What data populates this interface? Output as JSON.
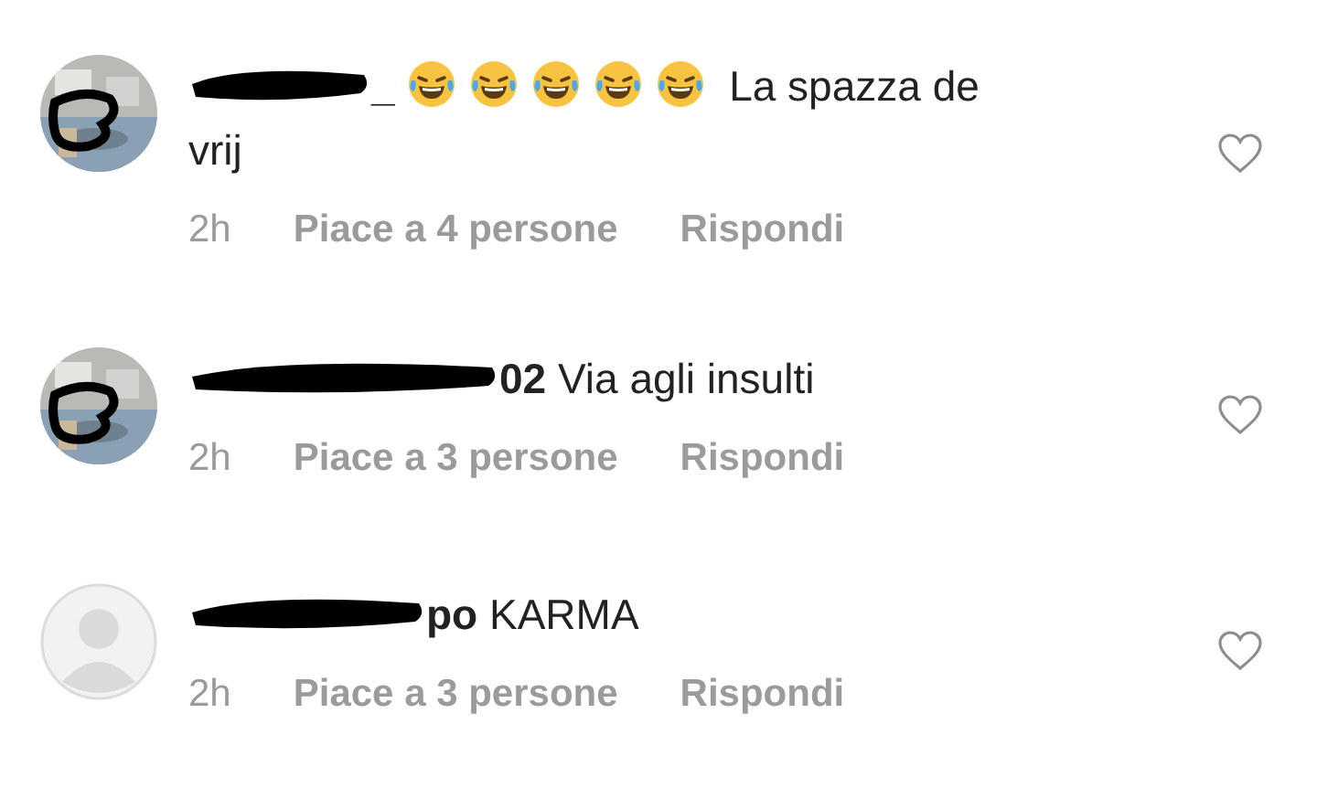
{
  "comments": [
    {
      "username_visible": "_",
      "icons": [
        {
          "kind": "laughing"
        },
        {
          "kind": "laughing"
        },
        {
          "kind": "laughing"
        },
        {
          "kind": "laughing"
        },
        {
          "kind": "laughing"
        }
      ],
      "text": "La spazza de vrij",
      "time": "2h",
      "likes": "Piace a 4 persone",
      "reply": "Rispondi"
    },
    {
      "username_visible": "02",
      "text": "Via agli insulti",
      "time": "2h",
      "likes": "Piace a 3 persone",
      "reply": "Rispondi"
    },
    {
      "avatar": {
        "kind": "default"
      },
      "username_visible": "po",
      "text": "KARMA",
      "time": "2h",
      "likes": "Piace a 3 persone",
      "reply": "Rispondi"
    }
  ]
}
